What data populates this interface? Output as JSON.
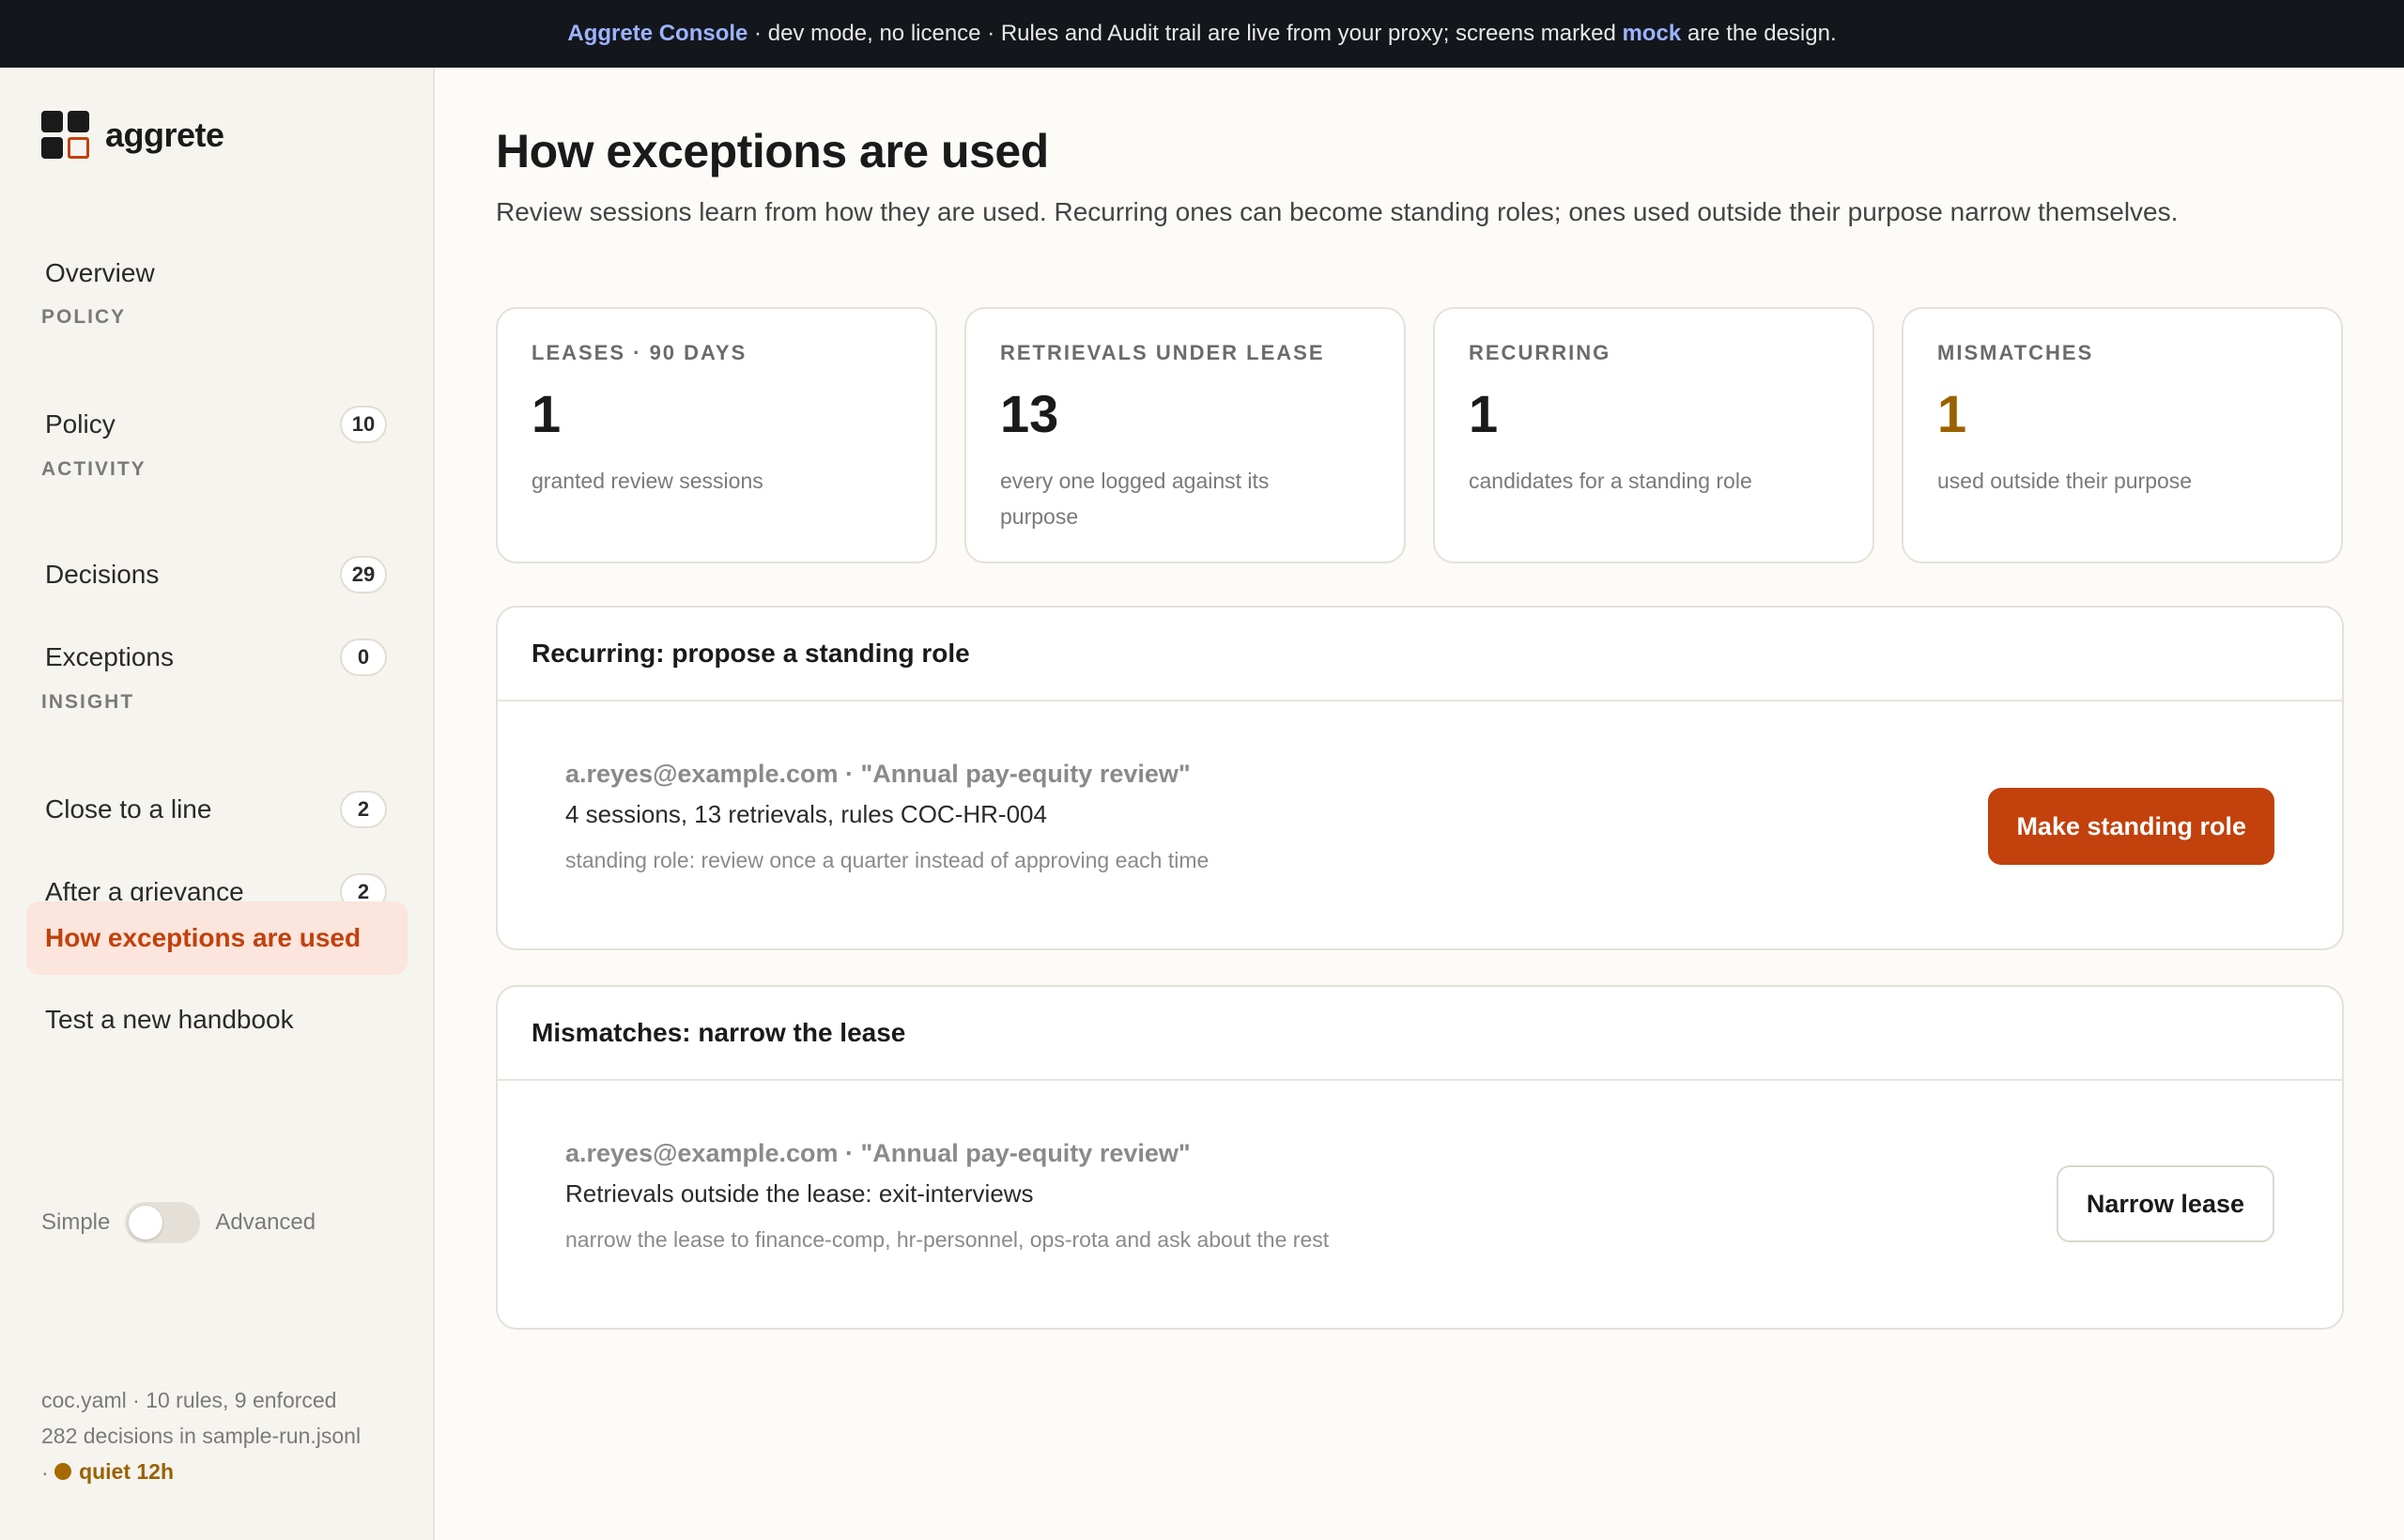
{
  "banner": {
    "app": "Aggrete Console",
    "pre": " · dev mode, no licence · Rules and Audit trail are live from your proxy; screens marked ",
    "mock": "mock",
    "post": " are the design."
  },
  "sidebar": {
    "brand": "aggrete",
    "overview": "Overview",
    "sections": {
      "policy": "POLICY",
      "activity": "ACTIVITY",
      "insight": "INSIGHT"
    },
    "items": [
      {
        "label": "Policy",
        "count": "10"
      },
      {
        "label": "Decisions",
        "count": "29"
      },
      {
        "label": "Exceptions",
        "count": "0"
      },
      {
        "label": "Close to a line",
        "count": "2"
      },
      {
        "label": "After a grievance",
        "count": "2"
      },
      {
        "label": "How exceptions are used"
      },
      {
        "label": "Test a new handbook"
      }
    ],
    "toggle": {
      "left": "Simple",
      "right": "Advanced",
      "on": false
    },
    "footer": {
      "line1": "coc.yaml · 10 rules, 9 enforced",
      "line2": "282 decisions in sample-run.jsonl",
      "sep": "·",
      "quiet": "quiet 12h"
    }
  },
  "page": {
    "title": "How exceptions are used",
    "subtitle": "Review sessions learn from how they are used. Recurring ones can become standing roles; ones used outside their purpose narrow themselves."
  },
  "stats": [
    {
      "label": "LEASES · 90 DAYS",
      "value": "1",
      "desc": "granted review sessions"
    },
    {
      "label": "RETRIEVALS UNDER LEASE",
      "value": "13",
      "desc": "every one logged against its purpose"
    },
    {
      "label": "RECURRING",
      "value": "1",
      "desc": "candidates for a standing role"
    },
    {
      "label": "MISMATCHES",
      "value": "1",
      "desc": "used outside their purpose"
    }
  ],
  "recurring": {
    "title": "Recurring: propose a standing role",
    "who": "a.reyes@example.com · \"Annual pay-equity review\"",
    "main": "4 sessions, 13 retrievals, rules COC-HR-004",
    "hint": "standing role: review once a quarter instead of approving each time",
    "button": "Make standing role"
  },
  "mismatches": {
    "title": "Mismatches: narrow the lease",
    "who": "a.reyes@example.com · \"Annual pay-equity review\"",
    "main": "Retrievals outside the lease: exit-interviews",
    "hint": "narrow the lease to finance-comp, hr-personnel, ops-rota and ask about the rest",
    "button": "Narrow lease"
  },
  "colors": {
    "accent": "#c2410c",
    "warn": "#9a6200",
    "banner_bg": "#13161b",
    "link": "#9bb3ff"
  }
}
